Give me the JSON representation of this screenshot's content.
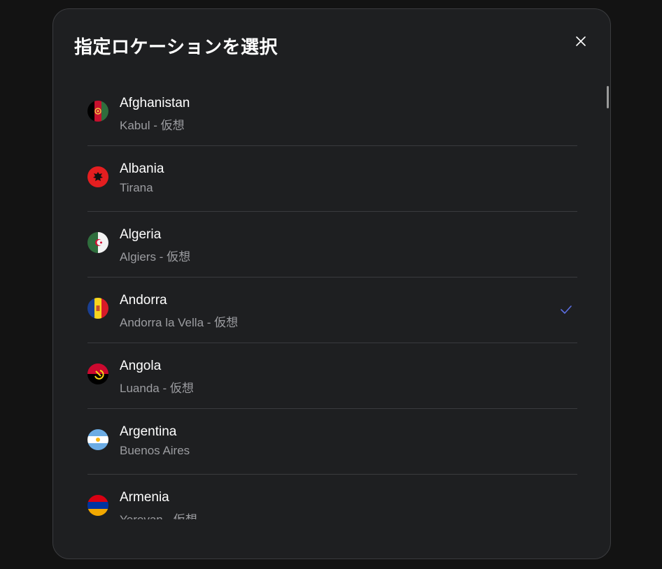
{
  "modal": {
    "title": "指定ロケーションを選択",
    "close_icon": "close-icon"
  },
  "locations": [
    {
      "country": "Afghanistan",
      "city": "Kabul - 仮想",
      "flag": "afghanistan-flag-icon",
      "selected": false
    },
    {
      "country": "Albania",
      "city": "Tirana",
      "flag": "albania-flag-icon",
      "selected": false
    },
    {
      "country": "Algeria",
      "city": "Algiers - 仮想",
      "flag": "algeria-flag-icon",
      "selected": false
    },
    {
      "country": "Andorra",
      "city": "Andorra la Vella - 仮想",
      "flag": "andorra-flag-icon",
      "selected": true
    },
    {
      "country": "Angola",
      "city": "Luanda - 仮想",
      "flag": "angola-flag-icon",
      "selected": false
    },
    {
      "country": "Argentina",
      "city": "Buenos Aires",
      "flag": "argentina-flag-icon",
      "selected": false
    },
    {
      "country": "Armenia",
      "city": "Yerevan - 仮想",
      "flag": "armenia-flag-icon",
      "selected": false
    }
  ],
  "colors": {
    "background": "#131313",
    "modal": "#1e1f21",
    "accent": "#5b6ee1",
    "secondary_text": "#9c9da1"
  }
}
